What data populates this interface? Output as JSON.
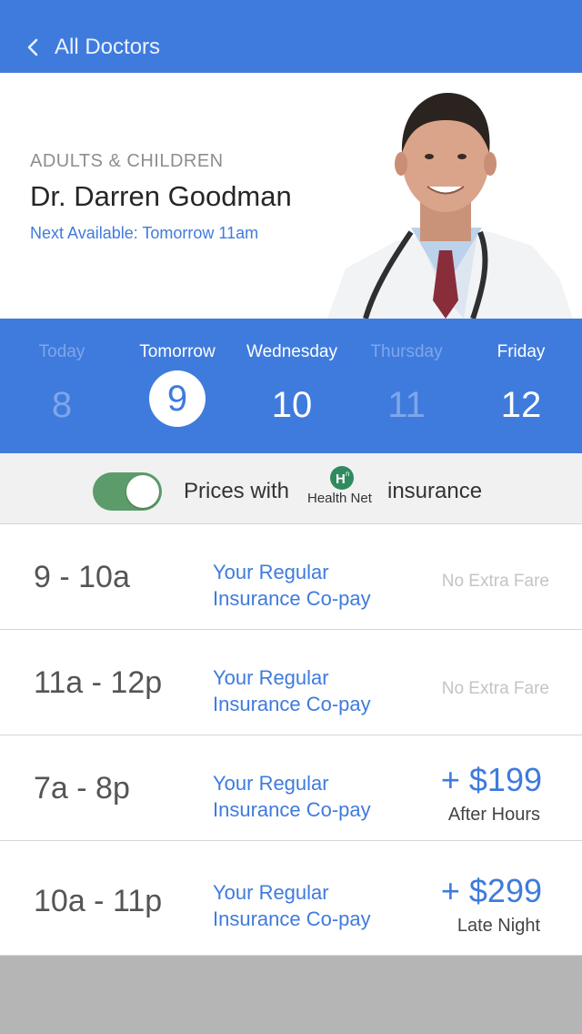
{
  "nav": {
    "back_label": "All Doctors"
  },
  "profile": {
    "category": "ADULTS & CHILDREN",
    "name": "Dr. Darren Goodman",
    "next_available": "Next Available: Tomorrow 11am"
  },
  "dates": [
    {
      "day": "Today",
      "num": "8",
      "state": "disabled"
    },
    {
      "day": "Tomorrow",
      "num": "9",
      "state": "selected"
    },
    {
      "day": "Wednesday",
      "num": "10",
      "state": "available"
    },
    {
      "day": "Thursday",
      "num": "11",
      "state": "disabled"
    },
    {
      "day": "Friday",
      "num": "12",
      "state": "available"
    }
  ],
  "insurance": {
    "prefix": "Prices with",
    "logo_text": "Health Net",
    "suffix": "insurance",
    "toggle_on": true
  },
  "slots": [
    {
      "time": "9 - 10a",
      "copay_line1": "Your Regular",
      "copay_line2": "Insurance Co-pay",
      "fare": "No Extra Fare"
    },
    {
      "time": "11a - 12p",
      "copay_line1": "Your Regular",
      "copay_line2": "Insurance Co-pay",
      "fare": "No Extra Fare"
    },
    {
      "time": "7a - 8p",
      "copay_line1": "Your Regular",
      "copay_line2": "Insurance Co-pay",
      "price": "+ $199",
      "price_note": "After Hours"
    },
    {
      "time": "10a - 11p",
      "copay_line1": "Your Regular",
      "copay_line2": "Insurance Co-pay",
      "price": "+ $299",
      "price_note": "Late Night"
    }
  ],
  "colors": {
    "accent": "#3f7bdd",
    "toggle_on": "#5c9b6a",
    "disabled_date": "#7ea6ea"
  }
}
